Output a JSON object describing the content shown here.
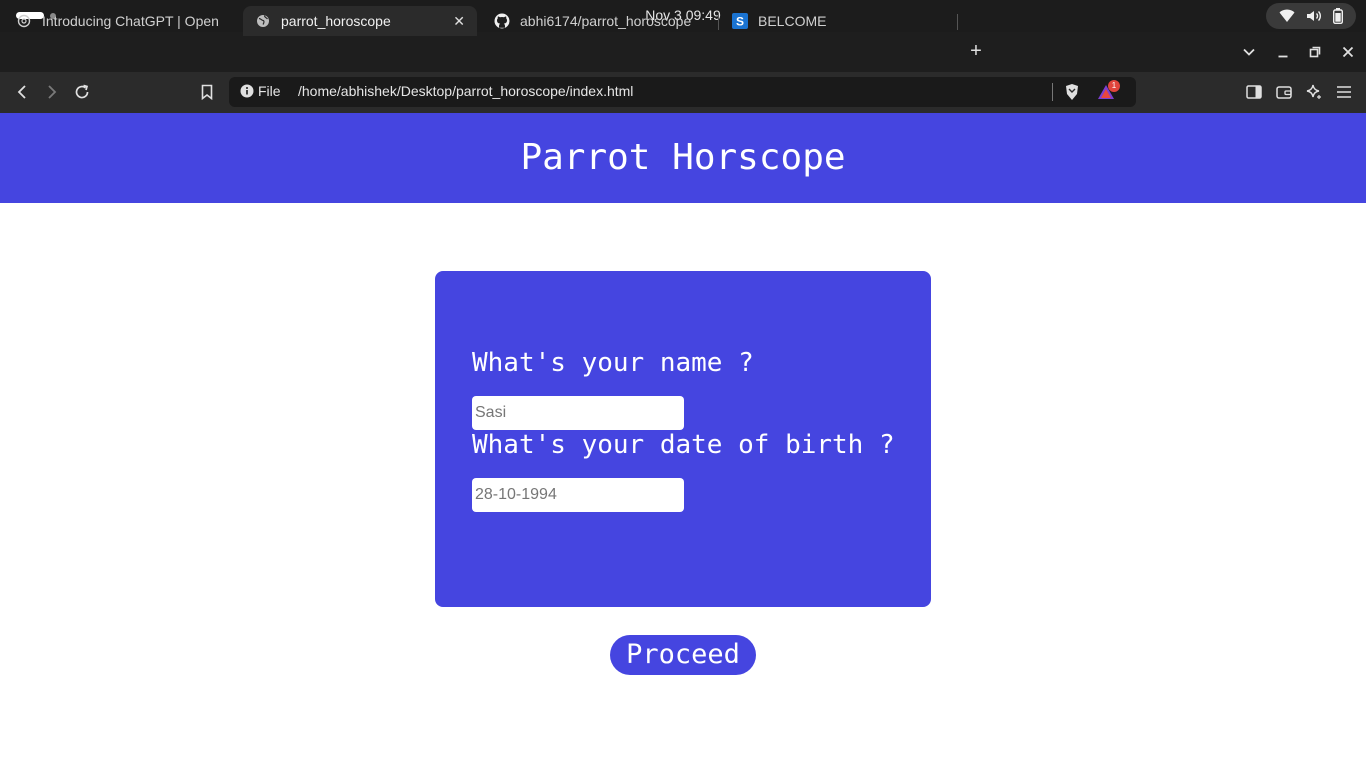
{
  "os": {
    "clock": "Nov 3  09:49",
    "tray_icons": [
      "wifi-icon",
      "volume-icon",
      "battery-icon"
    ]
  },
  "browser": {
    "tabs": [
      {
        "title": "Introducing ChatGPT | Open",
        "icon": "openai-icon",
        "active": false
      },
      {
        "title": "parrot_horoscope",
        "icon": "globe-icon",
        "active": true
      },
      {
        "title": "abhi6174/parrot_horoscope",
        "icon": "github-icon",
        "active": false
      },
      {
        "title": "BELCOME",
        "icon": "s-brand-icon",
        "active": false
      }
    ],
    "active_tab_close": "✕",
    "new_tab": "+",
    "address": {
      "scheme_label": "File",
      "url": "/home/abhishek/Desktop/parrot_horoscope/index.html"
    },
    "rewards_badge": "1"
  },
  "page": {
    "title": "Parrot Horscope",
    "form": {
      "name_label": "What's your name ?",
      "name_placeholder": "Sasi",
      "dob_label": "What's your date of birth ?",
      "dob_placeholder": "28-10-1994"
    },
    "proceed_label": "Proceed"
  },
  "colors": {
    "brand_blue": "#4545e0",
    "os_bar": "#1c1c1c",
    "toolbar": "#2b2b2b"
  }
}
